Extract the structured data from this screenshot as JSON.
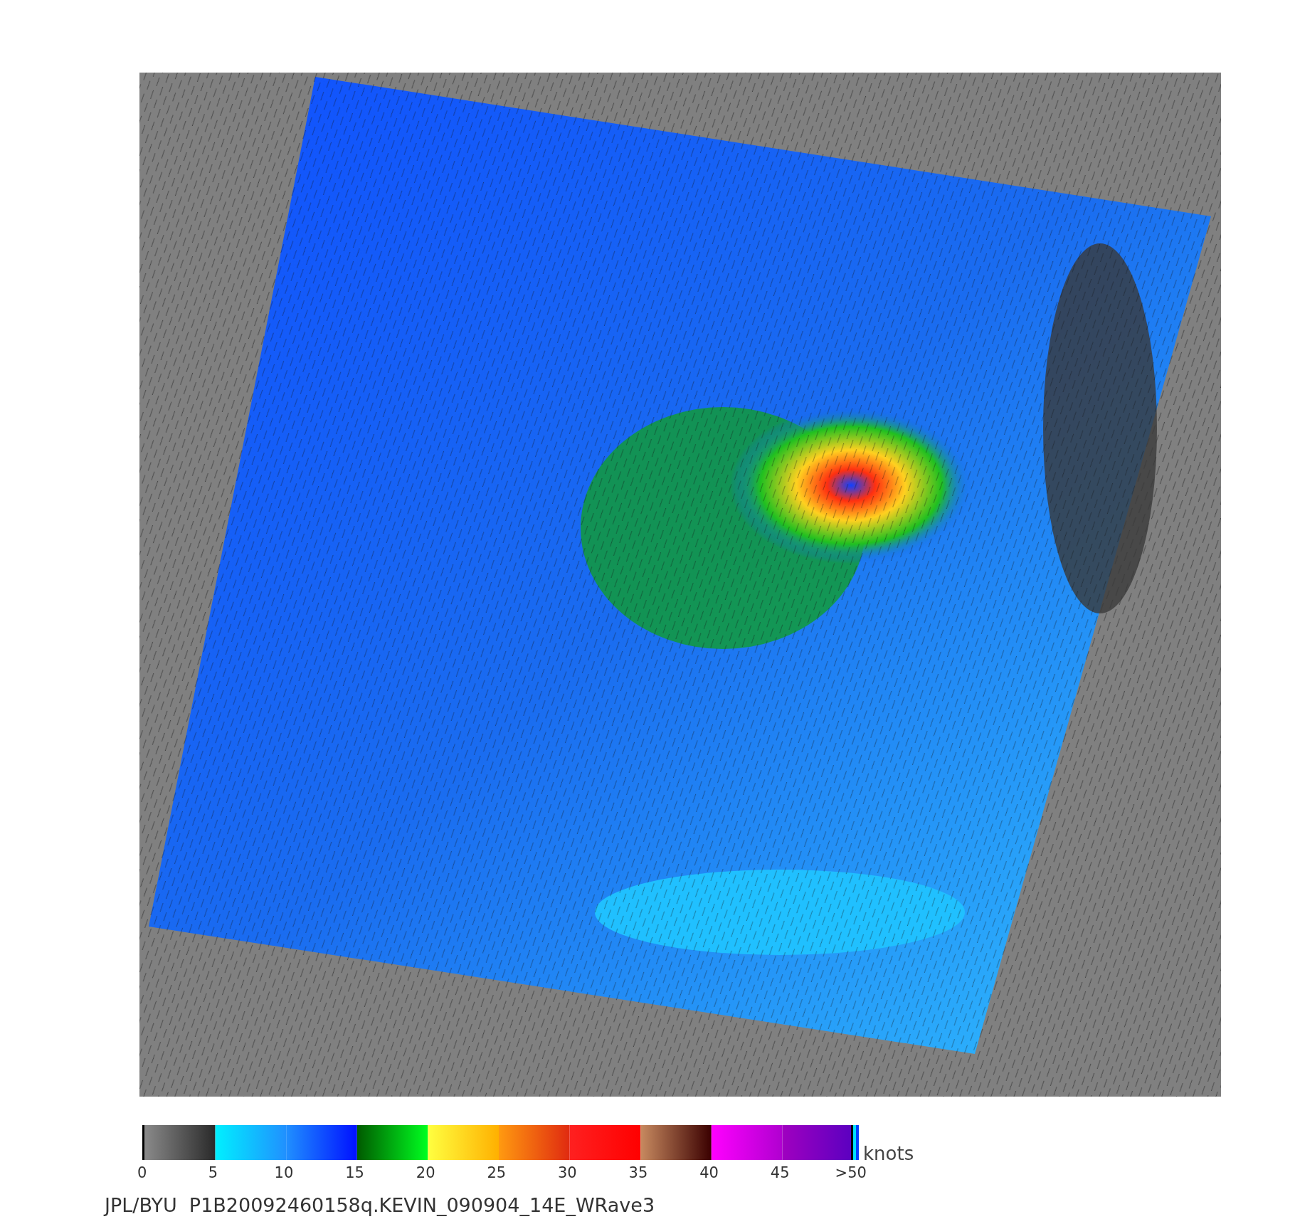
{
  "legend": {
    "ticks": [
      "0",
      "5",
      "10",
      "15",
      "20",
      "25",
      "30",
      "35",
      "40",
      "45",
      ">50"
    ],
    "unit": "knots"
  },
  "caption": "JPL/BYU  P1B20092460158q.KEVIN_090904_14E_WRave3"
}
